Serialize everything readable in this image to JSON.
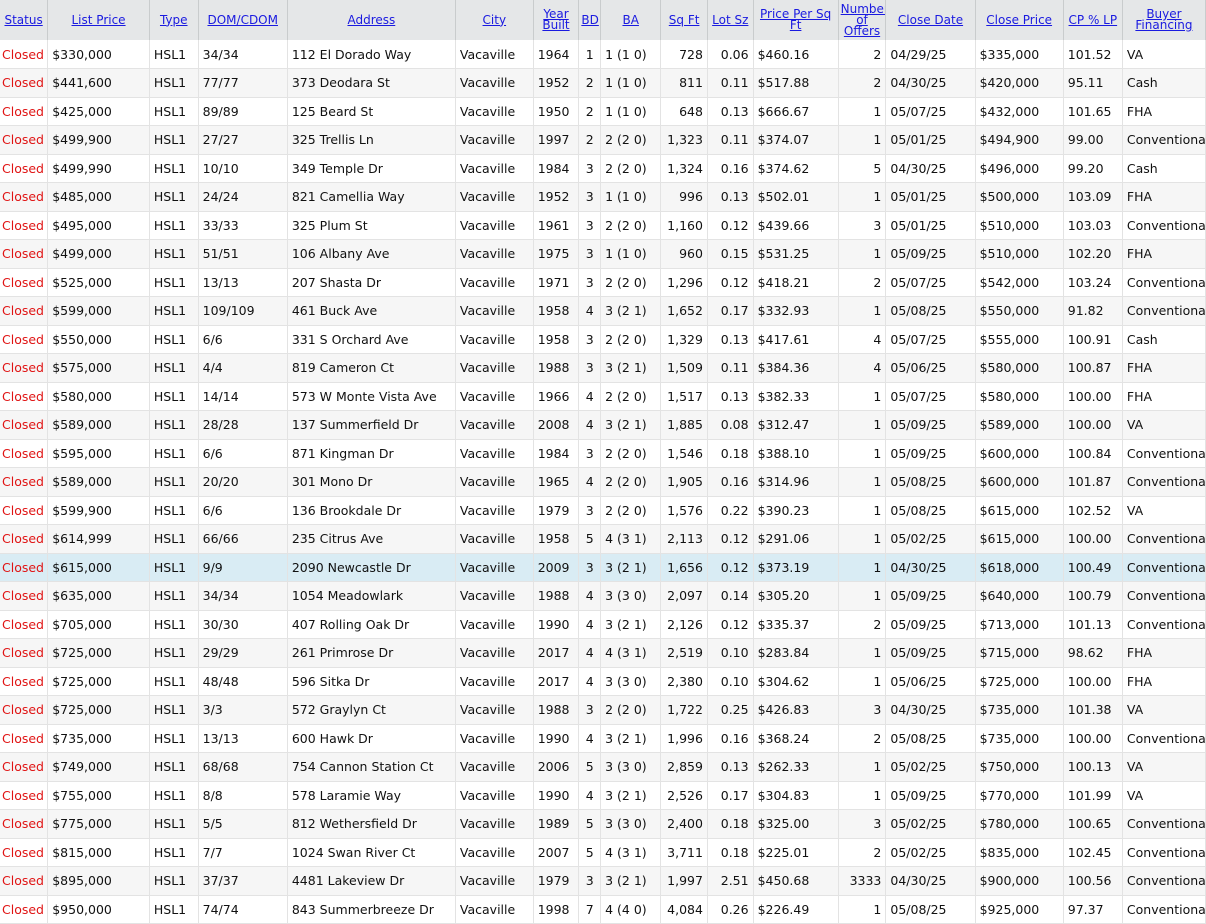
{
  "headers": [
    "Status",
    "List Price",
    "Type",
    "DOM/CDOM",
    "Address",
    "City",
    "Year Built",
    "BD",
    "BA",
    "Sq Ft",
    "Lot Sz",
    "Price Per Sq Ft",
    "Number of Offers",
    "Close Date",
    "Close Price",
    "CP % LP",
    "Buyer Financing"
  ],
  "rows": [
    [
      "Closed",
      "$330,000",
      "HSL1",
      "34/34",
      "112 El Dorado Way",
      "Vacaville",
      "1964",
      "1",
      "1 (1 0)",
      "728",
      "0.06",
      "$460.16",
      "2",
      "04/29/25",
      "$335,000",
      "101.52",
      "VA"
    ],
    [
      "Closed",
      "$441,600",
      "HSL1",
      "77/77",
      "373 Deodara St",
      "Vacaville",
      "1952",
      "2",
      "1 (1 0)",
      "811",
      "0.11",
      "$517.88",
      "2",
      "04/30/25",
      "$420,000",
      "95.11",
      "Cash"
    ],
    [
      "Closed",
      "$425,000",
      "HSL1",
      "89/89",
      "125 Beard St",
      "Vacaville",
      "1950",
      "2",
      "1 (1 0)",
      "648",
      "0.13",
      "$666.67",
      "1",
      "05/07/25",
      "$432,000",
      "101.65",
      "FHA"
    ],
    [
      "Closed",
      "$499,900",
      "HSL1",
      "27/27",
      "325 Trellis Ln",
      "Vacaville",
      "1997",
      "2",
      "2 (2 0)",
      "1,323",
      "0.11",
      "$374.07",
      "1",
      "05/01/25",
      "$494,900",
      "99.00",
      "Conventional"
    ],
    [
      "Closed",
      "$499,990",
      "HSL1",
      "10/10",
      "349 Temple Dr",
      "Vacaville",
      "1984",
      "3",
      "2 (2 0)",
      "1,324",
      "0.16",
      "$374.62",
      "5",
      "04/30/25",
      "$496,000",
      "99.20",
      "Cash"
    ],
    [
      "Closed",
      "$485,000",
      "HSL1",
      "24/24",
      "821 Camellia Way",
      "Vacaville",
      "1952",
      "3",
      "1 (1 0)",
      "996",
      "0.13",
      "$502.01",
      "1",
      "05/01/25",
      "$500,000",
      "103.09",
      "FHA"
    ],
    [
      "Closed",
      "$495,000",
      "HSL1",
      "33/33",
      "325 Plum St",
      "Vacaville",
      "1961",
      "3",
      "2 (2 0)",
      "1,160",
      "0.12",
      "$439.66",
      "3",
      "05/01/25",
      "$510,000",
      "103.03",
      "Conventional"
    ],
    [
      "Closed",
      "$499,000",
      "HSL1",
      "51/51",
      "106 Albany Ave",
      "Vacaville",
      "1975",
      "3",
      "1 (1 0)",
      "960",
      "0.15",
      "$531.25",
      "1",
      "05/09/25",
      "$510,000",
      "102.20",
      "FHA"
    ],
    [
      "Closed",
      "$525,000",
      "HSL1",
      "13/13",
      "207 Shasta Dr",
      "Vacaville",
      "1971",
      "3",
      "2 (2 0)",
      "1,296",
      "0.12",
      "$418.21",
      "2",
      "05/07/25",
      "$542,000",
      "103.24",
      "Conventional"
    ],
    [
      "Closed",
      "$599,000",
      "HSL1",
      "109/109",
      "461 Buck Ave",
      "Vacaville",
      "1958",
      "4",
      "3 (2 1)",
      "1,652",
      "0.17",
      "$332.93",
      "1",
      "05/08/25",
      "$550,000",
      "91.82",
      "Conventional"
    ],
    [
      "Closed",
      "$550,000",
      "HSL1",
      "6/6",
      "331 S Orchard Ave",
      "Vacaville",
      "1958",
      "3",
      "2 (2 0)",
      "1,329",
      "0.13",
      "$417.61",
      "4",
      "05/07/25",
      "$555,000",
      "100.91",
      "Cash"
    ],
    [
      "Closed",
      "$575,000",
      "HSL1",
      "4/4",
      "819 Cameron Ct",
      "Vacaville",
      "1988",
      "3",
      "3 (2 1)",
      "1,509",
      "0.11",
      "$384.36",
      "4",
      "05/06/25",
      "$580,000",
      "100.87",
      "FHA"
    ],
    [
      "Closed",
      "$580,000",
      "HSL1",
      "14/14",
      "573 W Monte Vista Ave",
      "Vacaville",
      "1966",
      "4",
      "2 (2 0)",
      "1,517",
      "0.13",
      "$382.33",
      "1",
      "05/07/25",
      "$580,000",
      "100.00",
      "FHA"
    ],
    [
      "Closed",
      "$589,000",
      "HSL1",
      "28/28",
      "137 Summerfield Dr",
      "Vacaville",
      "2008",
      "4",
      "3 (2 1)",
      "1,885",
      "0.08",
      "$312.47",
      "1",
      "05/09/25",
      "$589,000",
      "100.00",
      "VA"
    ],
    [
      "Closed",
      "$595,000",
      "HSL1",
      "6/6",
      "871 Kingman Dr",
      "Vacaville",
      "1984",
      "3",
      "2 (2 0)",
      "1,546",
      "0.18",
      "$388.10",
      "1",
      "05/09/25",
      "$600,000",
      "100.84",
      "Conventional"
    ],
    [
      "Closed",
      "$589,000",
      "HSL1",
      "20/20",
      "301 Mono Dr",
      "Vacaville",
      "1965",
      "4",
      "2 (2 0)",
      "1,905",
      "0.16",
      "$314.96",
      "1",
      "05/08/25",
      "$600,000",
      "101.87",
      "Conventional"
    ],
    [
      "Closed",
      "$599,900",
      "HSL1",
      "6/6",
      "136 Brookdale Dr",
      "Vacaville",
      "1979",
      "3",
      "2 (2 0)",
      "1,576",
      "0.22",
      "$390.23",
      "1",
      "05/08/25",
      "$615,000",
      "102.52",
      "VA"
    ],
    [
      "Closed",
      "$614,999",
      "HSL1",
      "66/66",
      "235 Citrus Ave",
      "Vacaville",
      "1958",
      "5",
      "4 (3 1)",
      "2,113",
      "0.12",
      "$291.06",
      "1",
      "05/02/25",
      "$615,000",
      "100.00",
      "Conventional"
    ],
    [
      "Closed",
      "$615,000",
      "HSL1",
      "9/9",
      "2090 Newcastle Dr",
      "Vacaville",
      "2009",
      "3",
      "3 (2 1)",
      "1,656",
      "0.12",
      "$373.19",
      "1",
      "04/30/25",
      "$618,000",
      "100.49",
      "Conventional"
    ],
    [
      "Closed",
      "$635,000",
      "HSL1",
      "34/34",
      "1054 Meadowlark",
      "Vacaville",
      "1988",
      "4",
      "3 (3 0)",
      "2,097",
      "0.14",
      "$305.20",
      "1",
      "05/09/25",
      "$640,000",
      "100.79",
      "Conventional"
    ],
    [
      "Closed",
      "$705,000",
      "HSL1",
      "30/30",
      "407 Rolling Oak Dr",
      "Vacaville",
      "1990",
      "4",
      "3 (2 1)",
      "2,126",
      "0.12",
      "$335.37",
      "2",
      "05/09/25",
      "$713,000",
      "101.13",
      "Conventional"
    ],
    [
      "Closed",
      "$725,000",
      "HSL1",
      "29/29",
      "261 Primrose Dr",
      "Vacaville",
      "2017",
      "4",
      "4 (3 1)",
      "2,519",
      "0.10",
      "$283.84",
      "1",
      "05/09/25",
      "$715,000",
      "98.62",
      "FHA"
    ],
    [
      "Closed",
      "$725,000",
      "HSL1",
      "48/48",
      "596 Sitka Dr",
      "Vacaville",
      "2017",
      "4",
      "3 (3 0)",
      "2,380",
      "0.10",
      "$304.62",
      "1",
      "05/06/25",
      "$725,000",
      "100.00",
      "FHA"
    ],
    [
      "Closed",
      "$725,000",
      "HSL1",
      "3/3",
      "572 Graylyn Ct",
      "Vacaville",
      "1988",
      "3",
      "2 (2 0)",
      "1,722",
      "0.25",
      "$426.83",
      "3",
      "04/30/25",
      "$735,000",
      "101.38",
      "VA"
    ],
    [
      "Closed",
      "$735,000",
      "HSL1",
      "13/13",
      "600 Hawk Dr",
      "Vacaville",
      "1990",
      "4",
      "3 (2 1)",
      "1,996",
      "0.16",
      "$368.24",
      "2",
      "05/08/25",
      "$735,000",
      "100.00",
      "Conventional"
    ],
    [
      "Closed",
      "$749,000",
      "HSL1",
      "68/68",
      "754 Cannon Station Ct",
      "Vacaville",
      "2006",
      "5",
      "3 (3 0)",
      "2,859",
      "0.13",
      "$262.33",
      "1",
      "05/02/25",
      "$750,000",
      "100.13",
      "VA"
    ],
    [
      "Closed",
      "$755,000",
      "HSL1",
      "8/8",
      "578 Laramie Way",
      "Vacaville",
      "1990",
      "4",
      "3 (2 1)",
      "2,526",
      "0.17",
      "$304.83",
      "1",
      "05/09/25",
      "$770,000",
      "101.99",
      "VA"
    ],
    [
      "Closed",
      "$775,000",
      "HSL1",
      "5/5",
      "812 Wethersfield Dr",
      "Vacaville",
      "1989",
      "5",
      "3 (3 0)",
      "2,400",
      "0.18",
      "$325.00",
      "3",
      "05/02/25",
      "$780,000",
      "100.65",
      "Conventional"
    ],
    [
      "Closed",
      "$815,000",
      "HSL1",
      "7/7",
      "1024 Swan River Ct",
      "Vacaville",
      "2007",
      "5",
      "4 (3 1)",
      "3,711",
      "0.18",
      "$225.01",
      "2",
      "05/02/25",
      "$835,000",
      "102.45",
      "Conventional"
    ],
    [
      "Closed",
      "$895,000",
      "HSL1",
      "37/37",
      "4481 Lakeview Dr",
      "Vacaville",
      "1979",
      "3",
      "3 (2 1)",
      "1,997",
      "2.51",
      "$450.68",
      "3333",
      "04/30/25",
      "$900,000",
      "100.56",
      "Conventional"
    ],
    [
      "Closed",
      "$950,000",
      "HSL1",
      "74/74",
      "843 Summerbreeze Dr",
      "Vacaville",
      "1998",
      "7",
      "4 (4 0)",
      "4,084",
      "0.26",
      "$226.49",
      "1",
      "05/08/25",
      "$925,000",
      "97.37",
      "Conventional"
    ]
  ],
  "highlighted_row": 18,
  "colors": {
    "header_bg": "#e5e7e8",
    "header_link": "#1a1ae0",
    "status_closed": "#e01414",
    "highlight_row": "#d9ecf4"
  }
}
